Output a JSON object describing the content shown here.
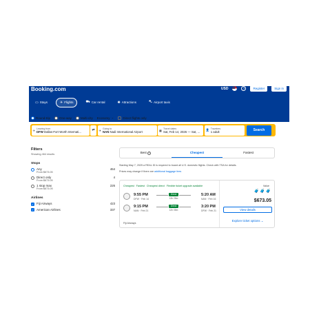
{
  "header": {
    "brand": "Booking.com",
    "currency": "USD",
    "help_symbol": "?",
    "register_label": "Register",
    "signin_label": "Sign in"
  },
  "nav": {
    "tabs": [
      {
        "label": "Stays",
        "icon": "bed-icon"
      },
      {
        "label": "Flights",
        "icon": "plane-icon",
        "active": true
      },
      {
        "label": "Car rental",
        "icon": "car-icon"
      },
      {
        "label": "Attractions",
        "icon": "attractions-icon"
      },
      {
        "label": "Airport taxis",
        "icon": "taxi-icon"
      }
    ]
  },
  "trip_options": {
    "round_trip": "Round-trip",
    "one_way": "One-way",
    "multi_city": "Multi-city",
    "cabin": "Economy",
    "direct_only": "Direct flights only"
  },
  "search": {
    "from_label": "Leaving from",
    "from_code": "DFW",
    "from_name": "Dallas-Fort Worth Internati...",
    "to_label": "Going to",
    "to_code": "NAN",
    "to_name": "Nadi International Airport",
    "dates_label": "Travel dates",
    "dates_value": "Sat, Feb 14, 2026 — Sat, ...",
    "travelers_label": "Travelers",
    "travelers_value": "1 adult",
    "button": "Search"
  },
  "filters": {
    "title": "Filters",
    "showing": "Showing 464 results",
    "stops_title": "Stops",
    "stops": [
      {
        "name": "Any",
        "price": "From $673.05",
        "count": "464",
        "checked": true
      },
      {
        "name": "Direct only",
        "price": "From $673.05",
        "count": "4"
      },
      {
        "name": "1 stop max",
        "price": "From $673.05",
        "count": "226"
      }
    ],
    "airlines_title": "Airlines",
    "airlines": [
      {
        "name": "Fiji Airways",
        "count": "423",
        "checked": true
      },
      {
        "name": "American Airlines",
        "count": "337",
        "checked": true
      }
    ]
  },
  "sort": {
    "tabs": [
      "Best",
      "Cheapest",
      "Fastest"
    ],
    "active": "Cheapest"
  },
  "notices": {
    "line1": "Starting May 7, 2025 a REAL ID is required to board all U.S. domestic flights. Check with TSA for details.",
    "line2_prefix": "Prices may change if there are",
    "line2_link": "additional baggage fees"
  },
  "result": {
    "badges": [
      "Cheapest",
      "Fastest",
      "Cheapest direct",
      "Flexible ticket upgrade available"
    ],
    "legs": [
      {
        "dep_time": "9:55 PM",
        "dep_sub": "DFW · Feb 14",
        "stops": "Direct",
        "duration": "13h 25m",
        "arr_time": "5:20 AM",
        "arr_sub": "NAN · Feb 16"
      },
      {
        "dep_time": "9:15 PM",
        "dep_sub": "NAN · Feb 21",
        "stops": "Direct",
        "duration": "12h 05m",
        "arr_time": "3:20 PM",
        "arr_sub": "DFW · Feb 21"
      }
    ],
    "airline": "Fiji Airways",
    "value_label": "Value",
    "price": "$673.05",
    "view_button": "View details",
    "explore_link": "Explore ticket options ⌄"
  }
}
